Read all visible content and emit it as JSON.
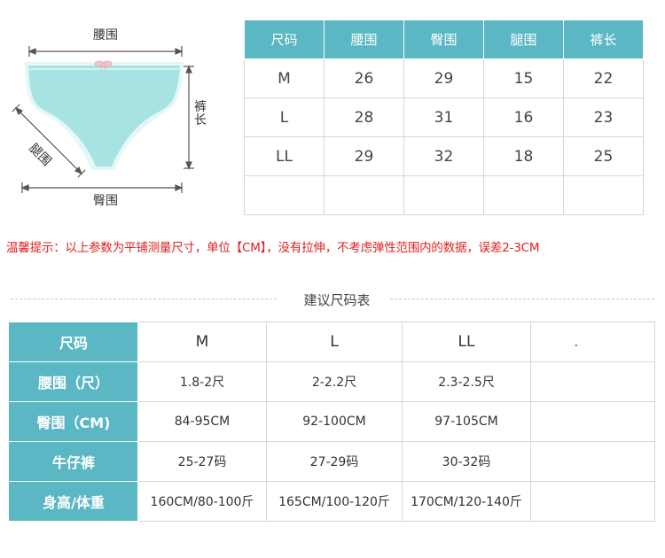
{
  "diagram": {
    "waist_label": "腰围",
    "hip_label": "臀围",
    "leg_label": "腿围",
    "length_label": "裤长",
    "colors": {
      "fill": "#a8e3e3",
      "stroke": "#e6f7f7",
      "bow": "#f2c6cc",
      "arrow": "#555555"
    }
  },
  "size_table": {
    "headers": [
      "尺码",
      "腰围",
      "臀围",
      "腿围",
      "裤长"
    ],
    "rows": [
      [
        "M",
        "26",
        "29",
        "15",
        "22"
      ],
      [
        "L",
        "28",
        "31",
        "16",
        "23"
      ],
      [
        "LL",
        "29",
        "32",
        "18",
        "25"
      ],
      [
        "",
        "",
        "",
        "",
        ""
      ]
    ]
  },
  "tip": "温馨提示：以上参数为平铺测量尺寸，单位【CM】，没有拉伸，不考虑弹性范围内的数据，误差2-3CM",
  "section_title": "建议尺码表",
  "rec_table": {
    "header_row": {
      "label": "尺码",
      "cells": [
        "M",
        "L",
        "LL",
        "."
      ]
    },
    "rows": [
      {
        "label": "腰围（尺）",
        "cells": [
          "1.8-2尺",
          "2-2.2尺",
          "2.3-2.5尺",
          ""
        ]
      },
      {
        "label": "臀围（CM)",
        "cells": [
          "84-95CM",
          "92-100CM",
          "97-105CM",
          ""
        ]
      },
      {
        "label": "牛仔裤",
        "cells": [
          "25-27码",
          "27-29码",
          "30-32码",
          ""
        ]
      },
      {
        "label": "身高/体重",
        "cells": [
          "160CM/80-100斤",
          "165CM/100-120斤",
          "170CM/120-140斤",
          ""
        ]
      }
    ]
  },
  "accent_color": "#5bb7c3",
  "tip_color": "#e02020"
}
